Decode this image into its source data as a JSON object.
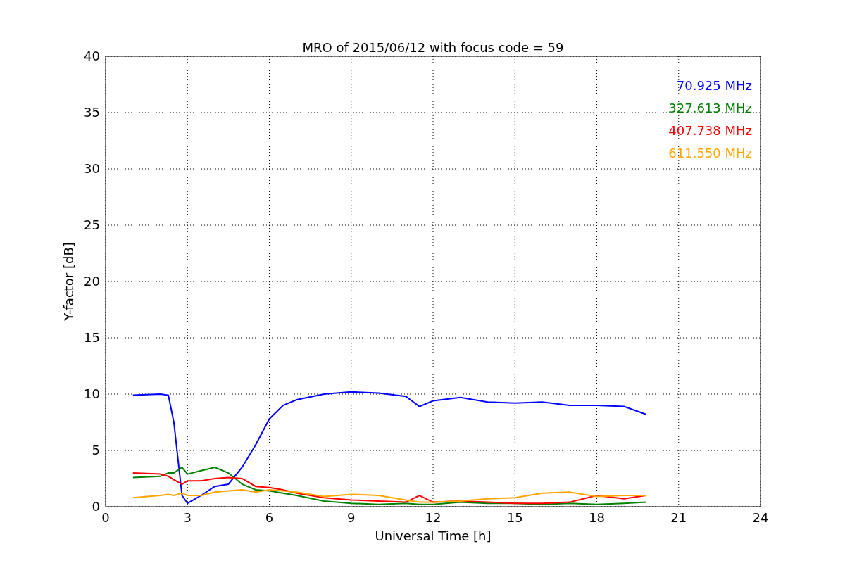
{
  "figure": {
    "chart_data": {
      "type": "line",
      "title": "MRO of 2015/06/12 with focus code = 59",
      "xlabel": "Universal Time [h]",
      "ylabel": "Y-factor [dB]",
      "xlim": [
        0,
        24
      ],
      "ylim": [
        0,
        40
      ],
      "xticks": [
        0,
        3,
        6,
        9,
        12,
        15,
        18,
        21,
        24
      ],
      "yticks": [
        0,
        5,
        10,
        15,
        20,
        25,
        30,
        35,
        40
      ],
      "grid": true,
      "x": [
        1,
        2,
        2.3,
        2.5,
        2.8,
        3,
        3.5,
        4,
        4.5,
        5,
        5.5,
        6,
        6.5,
        7,
        8,
        9,
        10,
        11,
        11.5,
        12,
        13,
        14,
        15,
        16,
        17,
        18,
        19,
        19.8
      ],
      "series": [
        {
          "name": "70.925 MHz",
          "color": "#0000ff",
          "values": [
            9.9,
            10,
            9.9,
            7.5,
            1.0,
            0.3,
            1.0,
            1.8,
            2.0,
            3.5,
            5.5,
            7.8,
            9.0,
            9.5,
            10,
            10.2,
            10.1,
            9.8,
            8.9,
            9.4,
            9.7,
            9.3,
            9.2,
            9.3,
            9.0,
            9.0,
            8.9,
            8.2
          ]
        },
        {
          "name": "327.613 MHz",
          "color": "#008000",
          "values": [
            2.6,
            2.7,
            3.0,
            3.0,
            3.5,
            2.9,
            3.2,
            3.5,
            3.0,
            2.0,
            1.5,
            1.4,
            1.2,
            1.0,
            0.5,
            0.3,
            0.2,
            0.3,
            0.2,
            0.2,
            0.4,
            0.3,
            0.3,
            0.2,
            0.3,
            0.2,
            0.3,
            0.4
          ]
        },
        {
          "name": "407.738 MHz",
          "color": "#ff0000",
          "values": [
            3.0,
            2.9,
            2.7,
            2.4,
            2.0,
            2.3,
            2.3,
            2.5,
            2.6,
            2.5,
            1.8,
            1.7,
            1.5,
            1.2,
            0.8,
            0.6,
            0.5,
            0.4,
            1.0,
            0.4,
            0.5,
            0.4,
            0.3,
            0.3,
            0.4,
            1.0,
            0.7,
            1.0
          ]
        },
        {
          "name": "611.550 MHz",
          "color": "#ffa500",
          "values": [
            0.8,
            1.0,
            1.1,
            1.0,
            1.2,
            1.0,
            1.0,
            1.3,
            1.4,
            1.5,
            1.3,
            1.5,
            1.4,
            1.3,
            0.9,
            1.1,
            1.0,
            0.6,
            0.4,
            0.4,
            0.5,
            0.7,
            0.8,
            1.2,
            1.3,
            0.9,
            1.0,
            1.0
          ]
        }
      ]
    }
  }
}
